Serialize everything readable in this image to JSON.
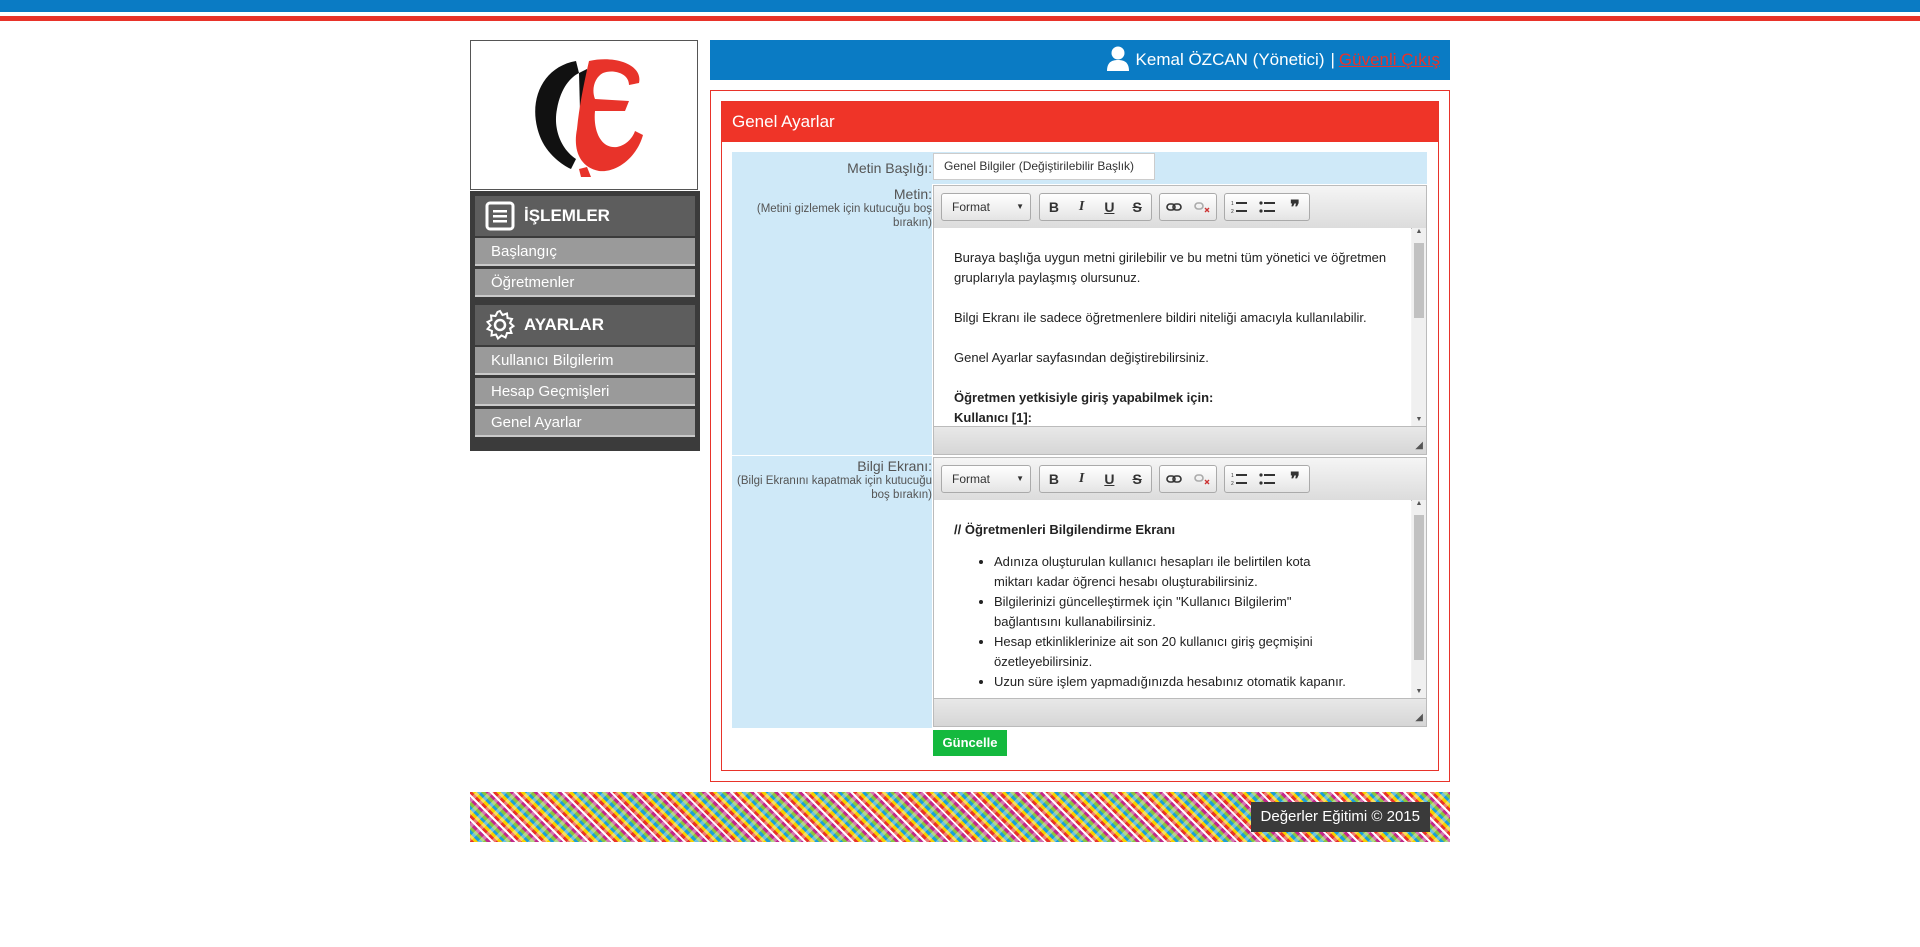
{
  "colors": {
    "brand_blue": "#0a7bc4",
    "brand_red": "#e8332a",
    "panel_red": "#ef3428",
    "update_green": "#14b93e",
    "row_bg": "#cfe9f8"
  },
  "sidebar": {
    "sections": [
      {
        "title": "İŞLEMLER",
        "icon": "list-icon",
        "items": [
          "Başlangıç",
          "Öğretmenler"
        ]
      },
      {
        "title": "AYARLAR",
        "icon": "gear-icon",
        "items": [
          "Kullanıcı Bilgilerim",
          "Hesap Geçmişleri",
          "Genel Ayarlar"
        ]
      }
    ]
  },
  "header": {
    "user_name": "Kemal ÖZCAN (Yönetici)",
    "separator": "|",
    "logout_label": "Güvenli Çıkış"
  },
  "panel": {
    "title": "Genel Ayarlar",
    "fields": {
      "text_title_label": "Metin Başlığı:",
      "text_title_value": "Genel Bilgiler (Değiştirilebilir Başlık)",
      "text_label": "Metin:",
      "text_hint": "(Metini gizlemek için kutucuğu boş bırakın)",
      "info_label": "Bilgi Ekranı:",
      "info_hint": "(Bilgi Ekranını kapatmak için kutucuğu boş bırakın)"
    },
    "editor_toolbar": {
      "format_label": "Format",
      "bold": "B",
      "italic": "I",
      "underline": "U",
      "strike": "S",
      "blockquote": "❞"
    },
    "editor1": {
      "p1": "Buraya başlığa uygun metni girilebilir ve bu metni tüm yönetici ve öğretmen gruplarıyla paylaşmış olursunuz.",
      "p2": "Bilgi Ekranı ile sadece öğretmenlere bildiri niteliği amacıyla kullanılabilir.",
      "p3": "Genel Ayarlar sayfasından değiştirebilirsiniz.",
      "bold1": "Öğretmen yetkisiyle giriş yapabilmek için:",
      "bold2": "Kullanıcı [1]:"
    },
    "editor2": {
      "heading": "// Öğretmenleri Bilgilendirme Ekranı",
      "items": [
        "Adınıza oluşturulan kullanıcı hesapları ile belirtilen kota miktarı kadar öğrenci hesabı oluşturabilirsiniz.",
        "Bilgilerinizi güncelleştirmek için \"Kullanıcı Bilgilerim\" bağlantısını kullanabilirsiniz.",
        "Hesap etkinliklerinize ait son 20 kullanıcı giriş geçmişini özetleyebilirsiniz.",
        "Uzun süre işlem yapmadığınızda hesabınız otomatik kapanır."
      ]
    },
    "update_label": "Güncelle"
  },
  "footer": {
    "copyright": "Değerler Eğitimi © 2015"
  }
}
